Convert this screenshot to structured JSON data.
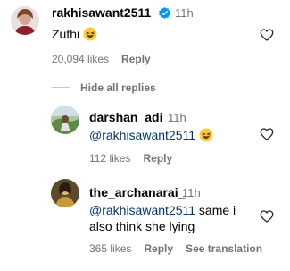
{
  "comments": [
    {
      "username": "rakhisawant2511",
      "verified": true,
      "time": "11h",
      "text": "Zuthi",
      "emoji": "laughing-face",
      "likes": "20,094 likes",
      "reply_label": "Reply"
    },
    {
      "username": "darshan_adi_",
      "time": "11h",
      "mention": "@rakhisawant2511",
      "emoji": "laughing-face",
      "likes": "112 likes",
      "reply_label": "Reply"
    },
    {
      "username": "the_archanarai_",
      "time": "11h",
      "mention": "@rakhisawant2511",
      "text_line1": " same i",
      "text_line2": "also think she lying",
      "likes": "365 likes",
      "reply_label": "Reply",
      "translate_label": "See translation"
    }
  ],
  "hide_replies_label": "Hide all replies",
  "colors": {
    "verified_badge": "#0095f6",
    "secondary_text": "#737373",
    "mention": "#00376b"
  }
}
